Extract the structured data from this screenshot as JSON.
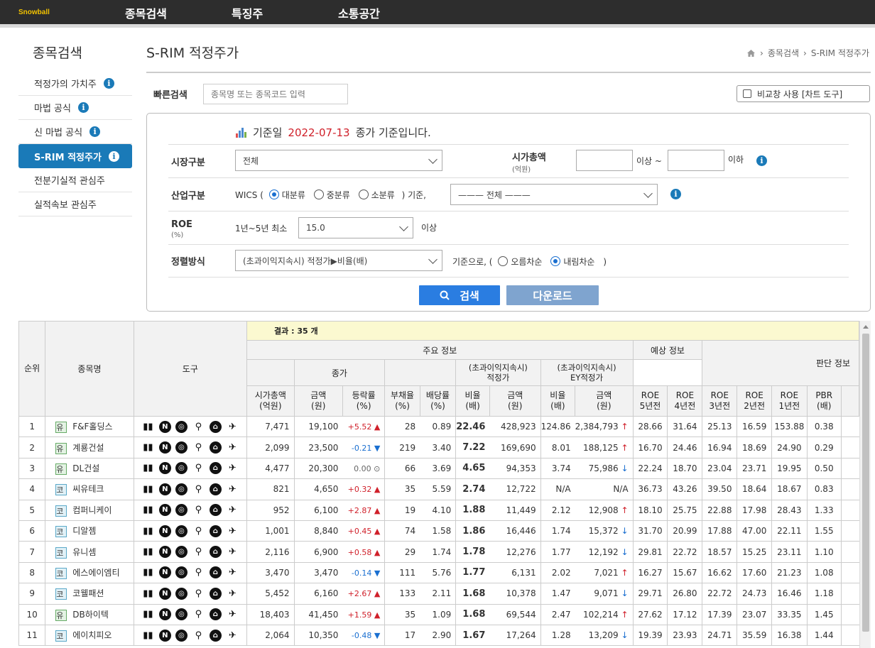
{
  "topbar": {
    "logo": "Snowball",
    "nav": [
      "종목검색",
      "특징주",
      "소통공간"
    ]
  },
  "sidebar": {
    "title": "종목검색",
    "items": [
      {
        "label": "적정가의 가치주",
        "info": true,
        "active": false
      },
      {
        "label": "마법 공식",
        "info": true,
        "active": false
      },
      {
        "label": "신 마법 공식",
        "info": true,
        "active": false
      },
      {
        "label": "S-RIM 적정주가",
        "info": true,
        "active": true
      },
      {
        "label": "전분기실적 관심주",
        "info": false,
        "active": false
      },
      {
        "label": "실적속보 관심주",
        "info": false,
        "active": false
      }
    ]
  },
  "page": {
    "title": "S-RIM 적정주가",
    "breadcrumb": [
      "종목검색",
      "S-RIM 적정주가"
    ]
  },
  "quick_search": {
    "label": "빠른검색",
    "placeholder": "종목명 또는 종목코드 입력",
    "compare_label": "비교창 사용 [차트 도구]"
  },
  "filter": {
    "head_prefix": "기준일",
    "head_date": "2022-07-13",
    "head_suffix": "종가 기준입니다.",
    "market_label": "시장구분",
    "market_value": "전체",
    "cap_label": "시가총액",
    "cap_unit": "(억원)",
    "cap_min_suffix": "이상 ~",
    "cap_max_suffix": "이하",
    "industry_label": "산업구분",
    "wics_prefix": "WICS (",
    "industry_options": [
      "대분류",
      "중분류",
      "소분류"
    ],
    "industry_selected": 0,
    "industry_suffix": ") 기준,",
    "industry_value": "——— 전체 ———",
    "roe_label": "ROE",
    "roe_unit": "(%)",
    "roe_prefix": "1년~5년 최소",
    "roe_value": "15.0",
    "roe_suffix": "이상",
    "sort_label": "정렬방식",
    "sort_value": "(초과이익지속시) 적정가▶비율(배)",
    "sort_prefix": "기준으로, (",
    "sort_options": [
      "오름차순",
      "내림차순"
    ],
    "sort_selected": 1,
    "sort_suffix": ")",
    "search_button": "검색",
    "download_button": "다운로드"
  },
  "table": {
    "result_label": "결과 : 35 개",
    "headers": {
      "rank": "순위",
      "name": "종목명",
      "tools": "도구",
      "main_info": "주요 정보",
      "forecast_info": "예상 정보",
      "judge_info": "판단 정보",
      "price_group": "종가",
      "fair_group": "(초과이익지속시)\n적정가",
      "ey_group": "(초과이익지속시)\nEY적정가",
      "market_cap": "시가총액\n(억원)",
      "price": "금액\n(원)",
      "change": "등락률\n(%)",
      "debt": "부채율\n(%)",
      "dividend": "배당률\n(%)",
      "fair_ratio": "비율\n(배)",
      "fair_price": "금액\n(원)",
      "ey_ratio": "비율\n(배)",
      "ey_price": "금액\n(원)",
      "roe5": "ROE\n5년전",
      "roe4": "ROE\n4년전",
      "roe3": "ROE\n3년전",
      "roe2": "ROE\n2년전",
      "roe1": "ROE\n1년전",
      "pbr": "PBR\n(배)"
    },
    "rows": [
      {
        "rank": "1",
        "market": "유",
        "name": "F&F홀딩스",
        "cap": "7,471",
        "price": "19,100",
        "chg": "+5.52",
        "dir": "up",
        "debt": "28",
        "div": "0.89",
        "fr": "22.46",
        "fp": "428,923",
        "er": "124.86",
        "ep": "2,384,793",
        "edir": "up",
        "r5": "28.66",
        "r4": "31.64",
        "r3": "25.13",
        "r2": "16.59",
        "r1": "153.88",
        "pbr": "0.38"
      },
      {
        "rank": "2",
        "market": "유",
        "name": "계룡건설",
        "cap": "2,099",
        "price": "23,500",
        "chg": "-0.21",
        "dir": "dn",
        "debt": "219",
        "div": "3.40",
        "fr": "7.22",
        "fp": "169,690",
        "er": "8.01",
        "ep": "188,125",
        "edir": "up",
        "r5": "16.70",
        "r4": "24.46",
        "r3": "16.94",
        "r2": "18.69",
        "r1": "24.90",
        "pbr": "0.29"
      },
      {
        "rank": "3",
        "market": "유",
        "name": "DL건설",
        "cap": "4,477",
        "price": "20,300",
        "chg": "0.00",
        "dir": "nc",
        "debt": "66",
        "div": "3.69",
        "fr": "4.65",
        "fp": "94,353",
        "er": "3.74",
        "ep": "75,986",
        "edir": "dn",
        "r5": "22.24",
        "r4": "18.70",
        "r3": "23.04",
        "r2": "23.71",
        "r1": "19.95",
        "pbr": "0.50"
      },
      {
        "rank": "4",
        "market": "코",
        "name": "씨유테크",
        "cap": "821",
        "price": "4,650",
        "chg": "+0.32",
        "dir": "up",
        "debt": "35",
        "div": "5.59",
        "fr": "2.74",
        "fp": "12,722",
        "er": "N/A",
        "ep": "N/A",
        "edir": "",
        "r5": "36.73",
        "r4": "43.26",
        "r3": "39.50",
        "r2": "18.64",
        "r1": "18.67",
        "pbr": "0.83"
      },
      {
        "rank": "5",
        "market": "코",
        "name": "컴퍼니케이",
        "cap": "952",
        "price": "6,100",
        "chg": "+2.87",
        "dir": "up",
        "debt": "19",
        "div": "4.10",
        "fr": "1.88",
        "fp": "11,449",
        "er": "2.12",
        "ep": "12,908",
        "edir": "up",
        "r5": "18.10",
        "r4": "25.75",
        "r3": "22.88",
        "r2": "17.98",
        "r1": "28.43",
        "pbr": "1.33"
      },
      {
        "rank": "6",
        "market": "코",
        "name": "디알젬",
        "cap": "1,001",
        "price": "8,840",
        "chg": "+0.45",
        "dir": "up",
        "debt": "74",
        "div": "1.58",
        "fr": "1.86",
        "fp": "16,446",
        "er": "1.74",
        "ep": "15,372",
        "edir": "dn",
        "r5": "31.70",
        "r4": "20.99",
        "r3": "17.88",
        "r2": "47.00",
        "r1": "22.11",
        "pbr": "1.55"
      },
      {
        "rank": "7",
        "market": "코",
        "name": "유니셈",
        "cap": "2,116",
        "price": "6,900",
        "chg": "+0.58",
        "dir": "up",
        "debt": "29",
        "div": "1.74",
        "fr": "1.78",
        "fp": "12,276",
        "er": "1.77",
        "ep": "12,192",
        "edir": "dn",
        "r5": "29.81",
        "r4": "22.72",
        "r3": "18.57",
        "r2": "15.25",
        "r1": "23.11",
        "pbr": "1.10"
      },
      {
        "rank": "8",
        "market": "코",
        "name": "에스에이엠티",
        "cap": "3,470",
        "price": "3,470",
        "chg": "-0.14",
        "dir": "dn",
        "debt": "111",
        "div": "5.76",
        "fr": "1.77",
        "fp": "6,131",
        "er": "2.02",
        "ep": "7,021",
        "edir": "up",
        "r5": "16.27",
        "r4": "15.67",
        "r3": "16.62",
        "r2": "17.60",
        "r1": "21.23",
        "pbr": "1.08"
      },
      {
        "rank": "9",
        "market": "코",
        "name": "코웰패션",
        "cap": "5,452",
        "price": "6,160",
        "chg": "+2.67",
        "dir": "up",
        "debt": "133",
        "div": "2.11",
        "fr": "1.68",
        "fp": "10,378",
        "er": "1.47",
        "ep": "9,071",
        "edir": "dn",
        "r5": "29.71",
        "r4": "26.80",
        "r3": "22.72",
        "r2": "24.73",
        "r1": "16.46",
        "pbr": "1.18"
      },
      {
        "rank": "10",
        "market": "유",
        "name": "DB하이텍",
        "cap": "18,403",
        "price": "41,450",
        "chg": "+1.59",
        "dir": "up",
        "debt": "35",
        "div": "1.09",
        "fr": "1.68",
        "fp": "69,544",
        "er": "2.47",
        "ep": "102,214",
        "edir": "up",
        "r5": "27.62",
        "r4": "17.12",
        "r3": "17.39",
        "r2": "23.07",
        "r1": "33.35",
        "pbr": "1.45"
      },
      {
        "rank": "11",
        "market": "코",
        "name": "에이치피오",
        "cap": "2,064",
        "price": "10,350",
        "chg": "-0.48",
        "dir": "dn",
        "debt": "17",
        "div": "2.90",
        "fr": "1.67",
        "fp": "17,264",
        "er": "1.28",
        "ep": "13,209",
        "edir": "dn",
        "r5": "19.39",
        "r4": "23.93",
        "r3": "24.71",
        "r2": "35.59",
        "r1": "16.38",
        "pbr": "1.44"
      }
    ]
  },
  "colors": {
    "nav_bg": "#2d2d2d",
    "accent": "#1a7ab8",
    "search_button": "#2a7de1",
    "download_button": "#7fa4cf",
    "up": "#d0202a",
    "down": "#1a6fd0"
  }
}
